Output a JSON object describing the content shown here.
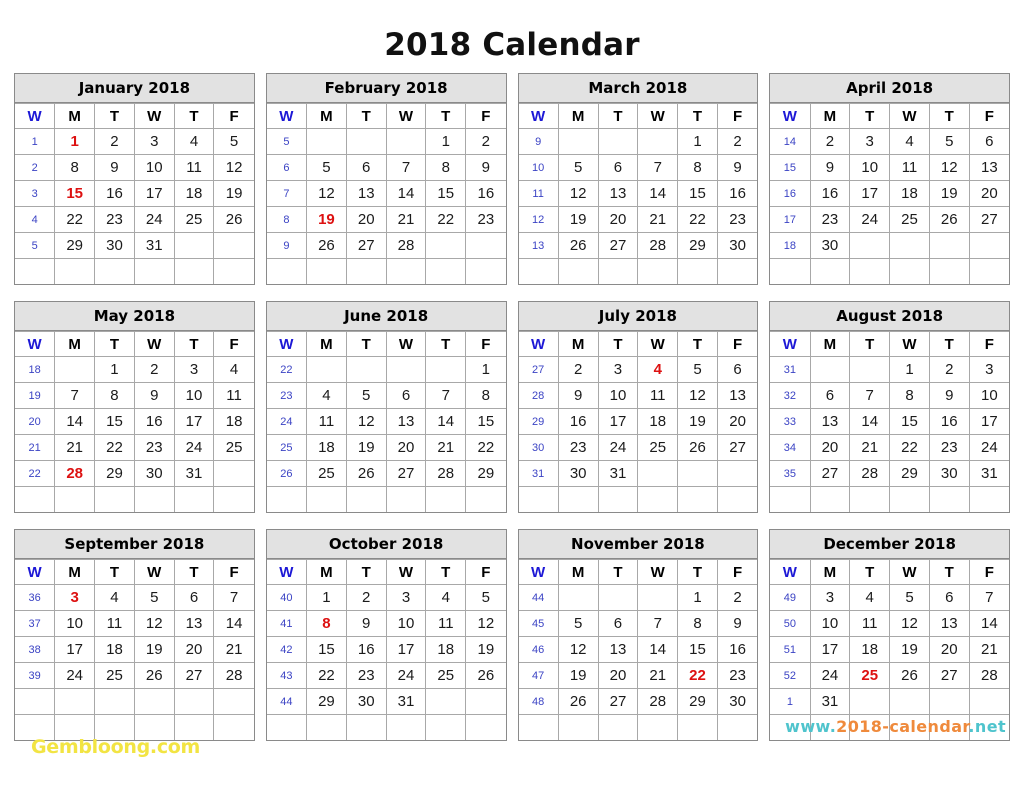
{
  "title": "2018 Calendar",
  "colors": {
    "week_number": "#3b43c4",
    "week_header": "#1d18d6",
    "holiday": "#dd1111",
    "day": "#1b1b1b",
    "month_header_bg": "#e2e2e2",
    "brand": "#f2e443",
    "url_teal": "#4fc4cd",
    "url_orange": "#ef8a3c"
  },
  "weekday_headers": [
    "W",
    "M",
    "T",
    "W",
    "T",
    "F"
  ],
  "footer": {
    "brand": "Gembloong.com",
    "url_prefix": "www.",
    "url_name": "2018-calendar",
    "url_suffix": ".net"
  },
  "months": [
    {
      "name": "January 2018",
      "rows": [
        {
          "week": "1",
          "days": [
            "1",
            "2",
            "3",
            "4",
            "5"
          ],
          "holidays": [
            "1"
          ]
        },
        {
          "week": "2",
          "days": [
            "8",
            "9",
            "10",
            "11",
            "12"
          ],
          "holidays": []
        },
        {
          "week": "3",
          "days": [
            "15",
            "16",
            "17",
            "18",
            "19"
          ],
          "holidays": [
            "15"
          ]
        },
        {
          "week": "4",
          "days": [
            "22",
            "23",
            "24",
            "25",
            "26"
          ],
          "holidays": []
        },
        {
          "week": "5",
          "days": [
            "29",
            "30",
            "31",
            "",
            ""
          ],
          "holidays": []
        },
        {
          "week": "",
          "days": [
            "",
            "",
            "",
            "",
            ""
          ],
          "holidays": []
        }
      ]
    },
    {
      "name": "February 2018",
      "rows": [
        {
          "week": "5",
          "days": [
            "",
            "",
            "",
            "1",
            "2"
          ],
          "holidays": []
        },
        {
          "week": "6",
          "days": [
            "5",
            "6",
            "7",
            "8",
            "9"
          ],
          "holidays": []
        },
        {
          "week": "7",
          "days": [
            "12",
            "13",
            "14",
            "15",
            "16"
          ],
          "holidays": []
        },
        {
          "week": "8",
          "days": [
            "19",
            "20",
            "21",
            "22",
            "23"
          ],
          "holidays": [
            "19"
          ]
        },
        {
          "week": "9",
          "days": [
            "26",
            "27",
            "28",
            "",
            ""
          ],
          "holidays": []
        },
        {
          "week": "",
          "days": [
            "",
            "",
            "",
            "",
            ""
          ],
          "holidays": []
        }
      ]
    },
    {
      "name": "March 2018",
      "rows": [
        {
          "week": "9",
          "days": [
            "",
            "",
            "",
            "1",
            "2"
          ],
          "holidays": []
        },
        {
          "week": "10",
          "days": [
            "5",
            "6",
            "7",
            "8",
            "9"
          ],
          "holidays": []
        },
        {
          "week": "11",
          "days": [
            "12",
            "13",
            "14",
            "15",
            "16"
          ],
          "holidays": []
        },
        {
          "week": "12",
          "days": [
            "19",
            "20",
            "21",
            "22",
            "23"
          ],
          "holidays": []
        },
        {
          "week": "13",
          "days": [
            "26",
            "27",
            "28",
            "29",
            "30"
          ],
          "holidays": []
        },
        {
          "week": "",
          "days": [
            "",
            "",
            "",
            "",
            ""
          ],
          "holidays": []
        }
      ]
    },
    {
      "name": "April 2018",
      "rows": [
        {
          "week": "14",
          "days": [
            "2",
            "3",
            "4",
            "5",
            "6"
          ],
          "holidays": []
        },
        {
          "week": "15",
          "days": [
            "9",
            "10",
            "11",
            "12",
            "13"
          ],
          "holidays": []
        },
        {
          "week": "16",
          "days": [
            "16",
            "17",
            "18",
            "19",
            "20"
          ],
          "holidays": []
        },
        {
          "week": "17",
          "days": [
            "23",
            "24",
            "25",
            "26",
            "27"
          ],
          "holidays": []
        },
        {
          "week": "18",
          "days": [
            "30",
            "",
            "",
            "",
            ""
          ],
          "holidays": []
        },
        {
          "week": "",
          "days": [
            "",
            "",
            "",
            "",
            ""
          ],
          "holidays": []
        }
      ]
    },
    {
      "name": "May 2018",
      "rows": [
        {
          "week": "18",
          "days": [
            "",
            "1",
            "2",
            "3",
            "4"
          ],
          "holidays": []
        },
        {
          "week": "19",
          "days": [
            "7",
            "8",
            "9",
            "10",
            "11"
          ],
          "holidays": []
        },
        {
          "week": "20",
          "days": [
            "14",
            "15",
            "16",
            "17",
            "18"
          ],
          "holidays": []
        },
        {
          "week": "21",
          "days": [
            "21",
            "22",
            "23",
            "24",
            "25"
          ],
          "holidays": []
        },
        {
          "week": "22",
          "days": [
            "28",
            "29",
            "30",
            "31",
            ""
          ],
          "holidays": [
            "28"
          ]
        },
        {
          "week": "",
          "days": [
            "",
            "",
            "",
            "",
            ""
          ],
          "holidays": []
        }
      ]
    },
    {
      "name": "June 2018",
      "rows": [
        {
          "week": "22",
          "days": [
            "",
            "",
            "",
            "",
            "1"
          ],
          "holidays": []
        },
        {
          "week": "23",
          "days": [
            "4",
            "5",
            "6",
            "7",
            "8"
          ],
          "holidays": []
        },
        {
          "week": "24",
          "days": [
            "11",
            "12",
            "13",
            "14",
            "15"
          ],
          "holidays": []
        },
        {
          "week": "25",
          "days": [
            "18",
            "19",
            "20",
            "21",
            "22"
          ],
          "holidays": []
        },
        {
          "week": "26",
          "days": [
            "25",
            "26",
            "27",
            "28",
            "29"
          ],
          "holidays": []
        },
        {
          "week": "",
          "days": [
            "",
            "",
            "",
            "",
            ""
          ],
          "holidays": []
        }
      ]
    },
    {
      "name": "July 2018",
      "rows": [
        {
          "week": "27",
          "days": [
            "2",
            "3",
            "4",
            "5",
            "6"
          ],
          "holidays": [
            "4"
          ]
        },
        {
          "week": "28",
          "days": [
            "9",
            "10",
            "11",
            "12",
            "13"
          ],
          "holidays": []
        },
        {
          "week": "29",
          "days": [
            "16",
            "17",
            "18",
            "19",
            "20"
          ],
          "holidays": []
        },
        {
          "week": "30",
          "days": [
            "23",
            "24",
            "25",
            "26",
            "27"
          ],
          "holidays": []
        },
        {
          "week": "31",
          "days": [
            "30",
            "31",
            "",
            "",
            ""
          ],
          "holidays": []
        },
        {
          "week": "",
          "days": [
            "",
            "",
            "",
            "",
            ""
          ],
          "holidays": []
        }
      ]
    },
    {
      "name": "August 2018",
      "rows": [
        {
          "week": "31",
          "days": [
            "",
            "",
            "1",
            "2",
            "3"
          ],
          "holidays": []
        },
        {
          "week": "32",
          "days": [
            "6",
            "7",
            "8",
            "9",
            "10"
          ],
          "holidays": []
        },
        {
          "week": "33",
          "days": [
            "13",
            "14",
            "15",
            "16",
            "17"
          ],
          "holidays": []
        },
        {
          "week": "34",
          "days": [
            "20",
            "21",
            "22",
            "23",
            "24"
          ],
          "holidays": []
        },
        {
          "week": "35",
          "days": [
            "27",
            "28",
            "29",
            "30",
            "31"
          ],
          "holidays": []
        },
        {
          "week": "",
          "days": [
            "",
            "",
            "",
            "",
            ""
          ],
          "holidays": []
        }
      ]
    },
    {
      "name": "September 2018",
      "rows": [
        {
          "week": "36",
          "days": [
            "3",
            "4",
            "5",
            "6",
            "7"
          ],
          "holidays": [
            "3"
          ]
        },
        {
          "week": "37",
          "days": [
            "10",
            "11",
            "12",
            "13",
            "14"
          ],
          "holidays": []
        },
        {
          "week": "38",
          "days": [
            "17",
            "18",
            "19",
            "20",
            "21"
          ],
          "holidays": []
        },
        {
          "week": "39",
          "days": [
            "24",
            "25",
            "26",
            "27",
            "28"
          ],
          "holidays": []
        },
        {
          "week": "",
          "days": [
            "",
            "",
            "",
            "",
            ""
          ],
          "holidays": []
        },
        {
          "week": "",
          "days": [
            "",
            "",
            "",
            "",
            ""
          ],
          "holidays": []
        }
      ]
    },
    {
      "name": "October 2018",
      "rows": [
        {
          "week": "40",
          "days": [
            "1",
            "2",
            "3",
            "4",
            "5"
          ],
          "holidays": []
        },
        {
          "week": "41",
          "days": [
            "8",
            "9",
            "10",
            "11",
            "12"
          ],
          "holidays": [
            "8"
          ]
        },
        {
          "week": "42",
          "days": [
            "15",
            "16",
            "17",
            "18",
            "19"
          ],
          "holidays": []
        },
        {
          "week": "43",
          "days": [
            "22",
            "23",
            "24",
            "25",
            "26"
          ],
          "holidays": []
        },
        {
          "week": "44",
          "days": [
            "29",
            "30",
            "31",
            "",
            ""
          ],
          "holidays": []
        },
        {
          "week": "",
          "days": [
            "",
            "",
            "",
            "",
            ""
          ],
          "holidays": []
        }
      ]
    },
    {
      "name": "November 2018",
      "rows": [
        {
          "week": "44",
          "days": [
            "",
            "",
            "",
            "1",
            "2"
          ],
          "holidays": []
        },
        {
          "week": "45",
          "days": [
            "5",
            "6",
            "7",
            "8",
            "9"
          ],
          "holidays": []
        },
        {
          "week": "46",
          "days": [
            "12",
            "13",
            "14",
            "15",
            "16"
          ],
          "holidays": []
        },
        {
          "week": "47",
          "days": [
            "19",
            "20",
            "21",
            "22",
            "23"
          ],
          "holidays": [
            "22"
          ]
        },
        {
          "week": "48",
          "days": [
            "26",
            "27",
            "28",
            "29",
            "30"
          ],
          "holidays": []
        },
        {
          "week": "",
          "days": [
            "",
            "",
            "",
            "",
            ""
          ],
          "holidays": []
        }
      ]
    },
    {
      "name": "December 2018",
      "rows": [
        {
          "week": "49",
          "days": [
            "3",
            "4",
            "5",
            "6",
            "7"
          ],
          "holidays": []
        },
        {
          "week": "50",
          "days": [
            "10",
            "11",
            "12",
            "13",
            "14"
          ],
          "holidays": []
        },
        {
          "week": "51",
          "days": [
            "17",
            "18",
            "19",
            "20",
            "21"
          ],
          "holidays": []
        },
        {
          "week": "52",
          "days": [
            "24",
            "25",
            "26",
            "27",
            "28"
          ],
          "holidays": [
            "25"
          ]
        },
        {
          "week": "1",
          "days": [
            "31",
            "",
            "",
            "",
            ""
          ],
          "holidays": []
        },
        {
          "week": "",
          "days": [
            "",
            "",
            "",
            "",
            ""
          ],
          "holidays": []
        }
      ]
    }
  ]
}
